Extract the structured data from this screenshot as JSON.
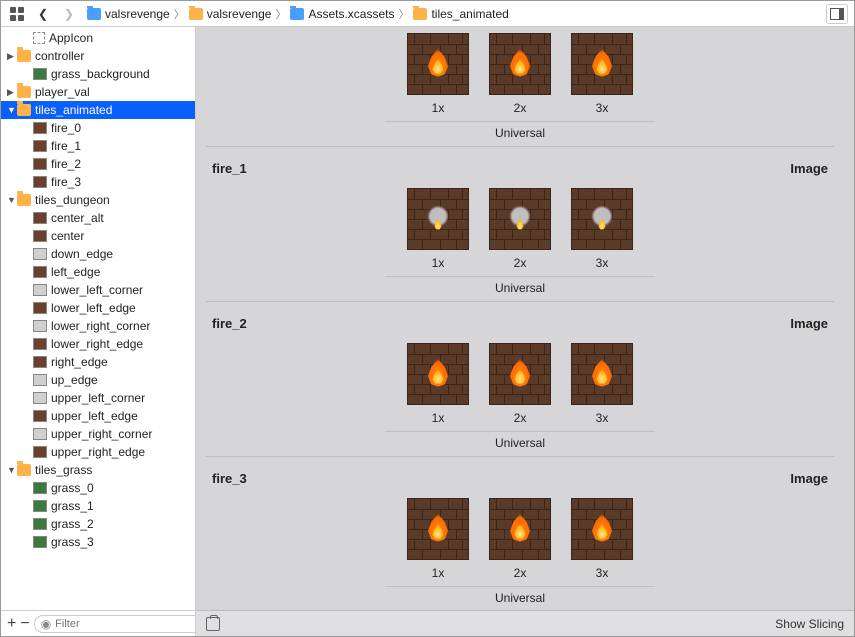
{
  "toolbar": {
    "breadcrumbs": [
      {
        "icon": "blue",
        "label": "valsrevenge"
      },
      {
        "icon": "orange",
        "label": "valsrevenge"
      },
      {
        "icon": "blue",
        "label": "Assets.xcassets"
      },
      {
        "icon": "orange",
        "label": "tiles_animated"
      }
    ]
  },
  "sidebar": {
    "items": [
      {
        "label": "AppIcon",
        "indent": 1,
        "icon": "appicon"
      },
      {
        "label": "controller",
        "indent": 0,
        "icon": "folder-orange",
        "disclosure": "closed"
      },
      {
        "label": "grass_background",
        "indent": 1,
        "icon": "img-green"
      },
      {
        "label": "player_val",
        "indent": 0,
        "icon": "folder-orange",
        "disclosure": "closed"
      },
      {
        "label": "tiles_animated",
        "indent": 0,
        "icon": "folder-orange",
        "disclosure": "open",
        "selected": true
      },
      {
        "label": "fire_0",
        "indent": 1,
        "icon": "img-brown"
      },
      {
        "label": "fire_1",
        "indent": 1,
        "icon": "img-brown"
      },
      {
        "label": "fire_2",
        "indent": 1,
        "icon": "img-brown"
      },
      {
        "label": "fire_3",
        "indent": 1,
        "icon": "img-brown"
      },
      {
        "label": "tiles_dungeon",
        "indent": 0,
        "icon": "folder-orange",
        "disclosure": "open"
      },
      {
        "label": "center_alt",
        "indent": 1,
        "icon": "img-brown"
      },
      {
        "label": "center",
        "indent": 1,
        "icon": "img-brown"
      },
      {
        "label": "down_edge",
        "indent": 1,
        "icon": "img-gray"
      },
      {
        "label": "left_edge",
        "indent": 1,
        "icon": "img-brown"
      },
      {
        "label": "lower_left_corner",
        "indent": 1,
        "icon": "img-gray"
      },
      {
        "label": "lower_left_edge",
        "indent": 1,
        "icon": "img-brown"
      },
      {
        "label": "lower_right_corner",
        "indent": 1,
        "icon": "img-gray"
      },
      {
        "label": "lower_right_edge",
        "indent": 1,
        "icon": "img-brown"
      },
      {
        "label": "right_edge",
        "indent": 1,
        "icon": "img-brown"
      },
      {
        "label": "up_edge",
        "indent": 1,
        "icon": "img-gray"
      },
      {
        "label": "upper_left_corner",
        "indent": 1,
        "icon": "img-gray"
      },
      {
        "label": "upper_left_edge",
        "indent": 1,
        "icon": "img-brown"
      },
      {
        "label": "upper_right_corner",
        "indent": 1,
        "icon": "img-gray"
      },
      {
        "label": "upper_right_edge",
        "indent": 1,
        "icon": "img-brown"
      },
      {
        "label": "tiles_grass",
        "indent": 0,
        "icon": "folder-orange",
        "disclosure": "open"
      },
      {
        "label": "grass_0",
        "indent": 1,
        "icon": "img-green"
      },
      {
        "label": "grass_1",
        "indent": 1,
        "icon": "img-green"
      },
      {
        "label": "grass_2",
        "indent": 1,
        "icon": "img-green"
      },
      {
        "label": "grass_3",
        "indent": 1,
        "icon": "img-green"
      }
    ],
    "filter_placeholder": "Filter"
  },
  "content": {
    "type_label": "Image",
    "scale_labels": [
      "1x",
      "2x",
      "3x"
    ],
    "universal_label": "Universal",
    "sections": [
      {
        "title": "",
        "flame": "big",
        "first": true
      },
      {
        "title": "fire_1",
        "flame": "small"
      },
      {
        "title": "fire_2",
        "flame": "big"
      },
      {
        "title": "fire_3",
        "flame": "big"
      }
    ],
    "footer": {
      "show_slicing": "Show Slicing"
    }
  }
}
